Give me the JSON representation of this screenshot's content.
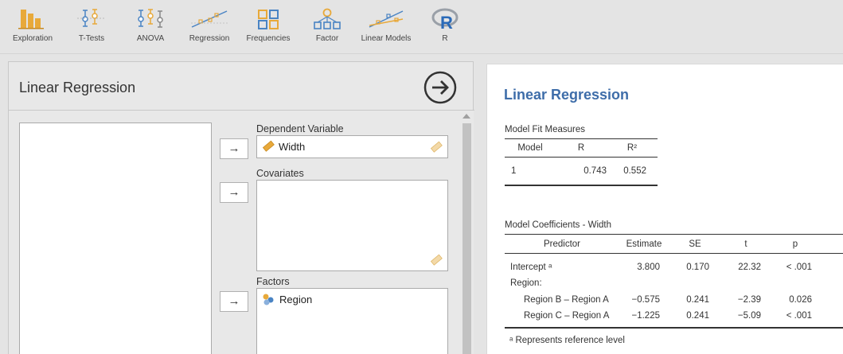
{
  "toolbar": {
    "items": [
      {
        "label": "Exploration",
        "icon": "bar-chart-icon"
      },
      {
        "label": "T-Tests",
        "icon": "t-tests-icon"
      },
      {
        "label": "ANOVA",
        "icon": "anova-icon"
      },
      {
        "label": "Regression",
        "icon": "regression-icon"
      },
      {
        "label": "Frequencies",
        "icon": "frequencies-icon"
      },
      {
        "label": "Factor",
        "icon": "factor-icon"
      },
      {
        "label": "Linear Models",
        "icon": "linear-models-icon"
      },
      {
        "label": "R",
        "icon": "r-logo-icon"
      }
    ]
  },
  "options": {
    "title": "Linear Regression",
    "arrow_label": "→",
    "dependent": {
      "label": "Dependent Variable",
      "variable": "Width"
    },
    "covariates": {
      "label": "Covariates"
    },
    "factors": {
      "label": "Factors",
      "variable": "Region"
    }
  },
  "results": {
    "title": "Linear Regression",
    "model_fit": {
      "caption": "Model Fit Measures",
      "headers": [
        "Model",
        "R",
        "R²"
      ],
      "rows": [
        [
          "1",
          "0.743",
          "0.552"
        ]
      ]
    },
    "coefficients": {
      "caption": "Model Coefficients - Width",
      "headers": [
        "Predictor",
        "Estimate",
        "SE",
        "t",
        "p"
      ],
      "rows": [
        [
          "Intercept ᵃ",
          "3.800",
          "0.170",
          "22.32",
          "< .001"
        ],
        [
          "Region:",
          "",
          "",
          "",
          ""
        ],
        [
          "Region B – Region A",
          "−0.575",
          "0.241",
          "−2.39",
          "0.026"
        ],
        [
          "Region C – Region A",
          "−1.225",
          "0.241",
          "−5.09",
          "< .001"
        ]
      ]
    },
    "footnote": "ᵃ Represents reference level"
  },
  "colors": {
    "accent_blue": "#3e6da9",
    "icon_orange": "#e8a93a",
    "icon_blue": "#4a84c4"
  }
}
